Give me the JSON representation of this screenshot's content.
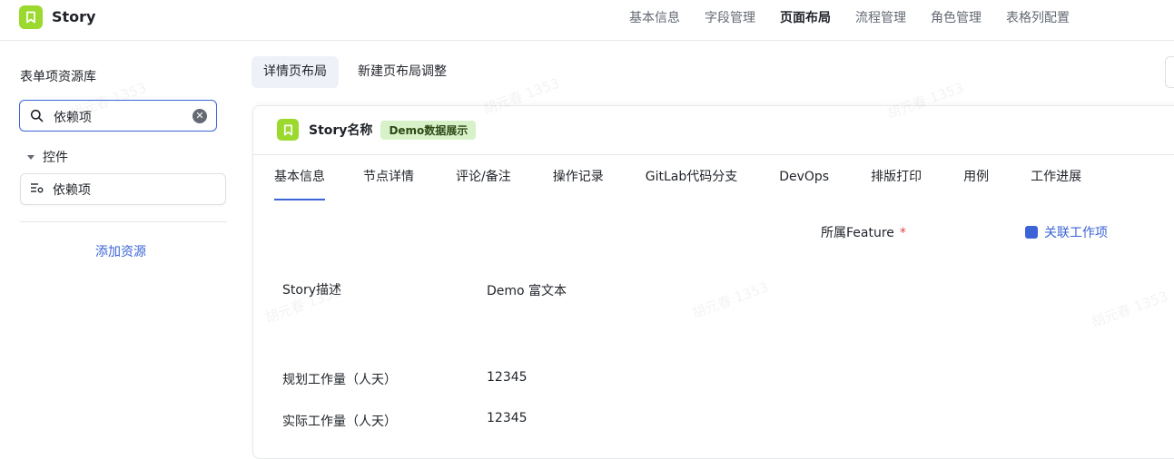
{
  "app": {
    "title": "Story"
  },
  "topnav": [
    {
      "label": "基本信息",
      "active": false
    },
    {
      "label": "字段管理",
      "active": false
    },
    {
      "label": "页面布局",
      "active": true
    },
    {
      "label": "流程管理",
      "active": false
    },
    {
      "label": "角色管理",
      "active": false
    },
    {
      "label": "表格列配置",
      "active": false
    }
  ],
  "sidebar": {
    "title": "表单项资源库",
    "search_value": "依赖项",
    "group_label": "控件",
    "items": [
      {
        "label": "依赖项"
      }
    ],
    "add_resource": "添加资源"
  },
  "subtabs": [
    {
      "label": "详情页布局",
      "active": true
    },
    {
      "label": "新建页布局调整",
      "active": false
    }
  ],
  "card": {
    "title": "Story名称",
    "badge": "Demo数据展示",
    "tabs": [
      {
        "label": "基本信息",
        "active": true
      },
      {
        "label": "节点详情",
        "active": false
      },
      {
        "label": "评论/备注",
        "active": false
      },
      {
        "label": "操作记录",
        "active": false
      },
      {
        "label": "GitLab代码分支",
        "active": false
      },
      {
        "label": "DevOps",
        "active": false
      },
      {
        "label": "排版打印",
        "active": false
      },
      {
        "label": "用例",
        "active": false
      },
      {
        "label": "工作进展",
        "active": false
      }
    ],
    "fields": {
      "feature_label": "所属Feature",
      "feature_required": "*",
      "feature_link": "关联工作项",
      "desc_label": "Story描述",
      "desc_value": "Demo 富文本",
      "plan_label": "规划工作量（人天）",
      "plan_value": "12345",
      "actual_label": "实际工作量（人天）",
      "actual_value": "12345"
    }
  },
  "watermark": "胡元春 1353",
  "colors": {
    "brand": "#9bd92f",
    "accent": "#3c64d6",
    "badge_bg": "#d7f2c9",
    "required": "#e23d3d"
  }
}
